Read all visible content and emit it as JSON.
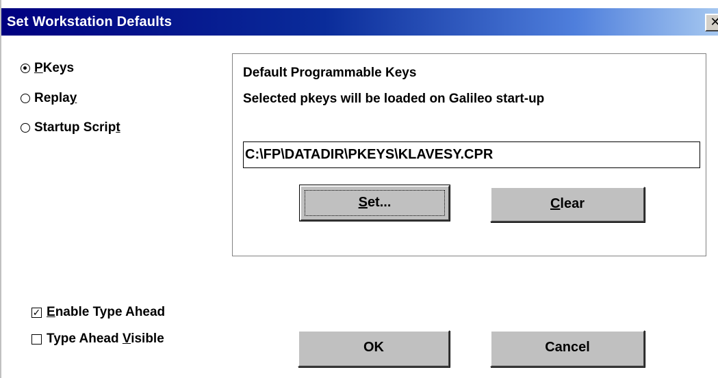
{
  "window": {
    "title": "Set Workstation Defaults",
    "close_glyph": "✕"
  },
  "radios": [
    {
      "prefix": "",
      "accel": "P",
      "suffix": "Keys",
      "checked": true
    },
    {
      "prefix": "Repla",
      "accel": "y",
      "suffix": "",
      "checked": false
    },
    {
      "prefix": "Startup Scrip",
      "accel": "t",
      "suffix": "",
      "checked": false
    }
  ],
  "group": {
    "heading": "Default Programmable Keys",
    "description": "Selected pkeys will be loaded on Galileo start-up",
    "path_value": "C:\\FP\\DATADIR\\PKEYS\\KLAVESY.CPR",
    "set_button": {
      "accel": "S",
      "rest": "et..."
    },
    "clear_button": {
      "accel": "C",
      "rest": "lear"
    }
  },
  "checkboxes": [
    {
      "prefix": "",
      "accel": "E",
      "suffix": "nable Type Ahead",
      "checked": true,
      "check_glyph": "✓"
    },
    {
      "prefix": "Type Ahead ",
      "accel": "V",
      "suffix": "isible",
      "checked": false,
      "check_glyph": ""
    }
  ],
  "buttons": {
    "ok": "OK",
    "cancel": "Cancel"
  },
  "colors": {
    "title_bar_start": "#000080",
    "title_bar_end": "#a6c8f0",
    "button_face": "#c0c0c0",
    "background": "#ffffff"
  }
}
